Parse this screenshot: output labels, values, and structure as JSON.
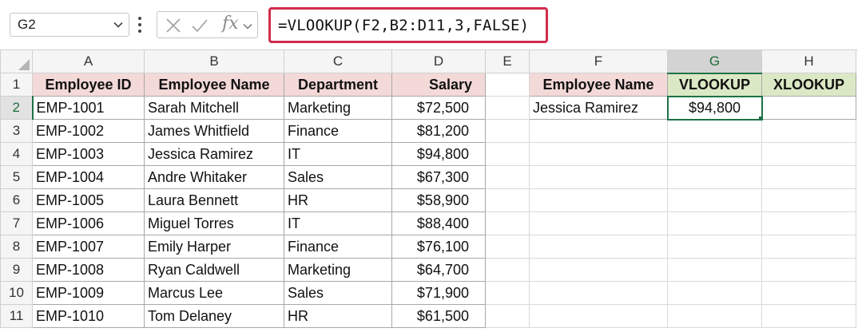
{
  "name_box": {
    "value": "G2"
  },
  "formula_bar": {
    "fx_label": "fx",
    "formula": "=VLOOKUP(F2,B2:D11,3,FALSE)"
  },
  "columns": [
    "A",
    "B",
    "C",
    "D",
    "E",
    "F",
    "G",
    "H"
  ],
  "rows": [
    "1",
    "2",
    "3",
    "4",
    "5",
    "6",
    "7",
    "8",
    "9",
    "10",
    "11"
  ],
  "table": {
    "headers": [
      "Employee ID",
      "Employee Name",
      "Department",
      "Salary"
    ],
    "data": [
      [
        "EMP-1001",
        "Sarah Mitchell",
        "Marketing",
        "$72,500"
      ],
      [
        "EMP-1002",
        "James Whitfield",
        "Finance",
        "$81,200"
      ],
      [
        "EMP-1003",
        "Jessica Ramirez",
        "IT",
        "$94,800"
      ],
      [
        "EMP-1004",
        "Andre Whitaker",
        "Sales",
        "$67,300"
      ],
      [
        "EMP-1005",
        "Laura Bennett",
        "HR",
        "$58,900"
      ],
      [
        "EMP-1006",
        "Miguel Torres",
        "IT",
        "$88,400"
      ],
      [
        "EMP-1007",
        "Emily Harper",
        "Finance",
        "$76,100"
      ],
      [
        "EMP-1008",
        "Ryan Caldwell",
        "Marketing",
        "$64,700"
      ],
      [
        "EMP-1009",
        "Marcus Lee",
        "Sales",
        "$71,900"
      ],
      [
        "EMP-1010",
        "Tom Delaney",
        "HR",
        "$61,500"
      ]
    ]
  },
  "lookup": {
    "headers": [
      "Employee Name",
      "VLOOKUP",
      "XLOOKUP"
    ],
    "values": [
      "Jessica Ramirez",
      "$94,800",
      ""
    ]
  },
  "colors": {
    "selection": "#1e7145",
    "header_pink": "#f4d9d9",
    "header_green": "#dbe8c5",
    "formula_highlight": "#d22b4b"
  }
}
